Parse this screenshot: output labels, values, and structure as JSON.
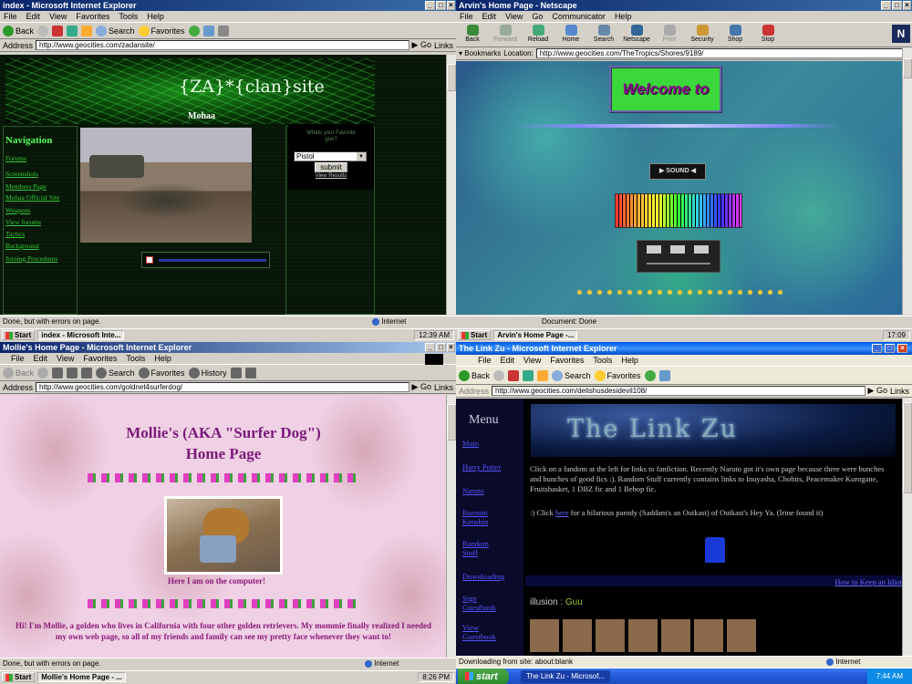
{
  "q1": {
    "title": "index - Microsoft Internet Explorer",
    "menu": [
      "File",
      "Edit",
      "View",
      "Favorites",
      "Tools",
      "Help"
    ],
    "toolbar": {
      "back": "Back",
      "search": "Search",
      "favorites": "Favorites"
    },
    "address_label": "Address",
    "url": "http://www.geocities.com/zadansite/",
    "go": "Go",
    "links": "Links",
    "site_title": "{ZA}*{clan}site",
    "site_sub": "Mohaa",
    "nav_title": "Navigation",
    "nav": [
      "Forums",
      "Screenshots",
      "Members Page",
      "Mohaa Official Site",
      "Weapons",
      "View forums",
      "Tactics",
      "Background",
      "Joining Procedures"
    ],
    "poll": {
      "question": "Whats your Favorite gun?",
      "selected": "Pistol",
      "submit": "submit",
      "results": "View Results"
    },
    "status": "Done, but with errors on page.",
    "zone": "Internet",
    "taskbar": {
      "start": "Start",
      "task": "index - Microsoft Inte...",
      "clock": "12:39 AM"
    }
  },
  "q2": {
    "title": "Arvin's Home Page - Netscape",
    "menu": [
      "File",
      "Edit",
      "View",
      "Go",
      "Communicator",
      "Help"
    ],
    "toolbar": [
      "Back",
      "Forward",
      "Reload",
      "Home",
      "Search",
      "Netscape",
      "Print",
      "Security",
      "Shop",
      "Stop"
    ],
    "bookmarks": "Bookmarks",
    "location_label": "Location:",
    "url": "http://www.geocities.com/TheTropics/Shores/9189/",
    "welcome": "Welcome to",
    "sound": "SOUND",
    "status": "Document: Done",
    "taskbar": {
      "start": "Start",
      "task": "Arvin's Home Page -...",
      "clock": "17:09"
    }
  },
  "q3": {
    "title": "Mollie's Home Page - Microsoft Internet Explorer",
    "menu": [
      "File",
      "Edit",
      "View",
      "Favorites",
      "Tools",
      "Help"
    ],
    "toolbar": {
      "back": "Back",
      "search": "Search",
      "favorites": "Favorites",
      "history": "History"
    },
    "address_label": "Address",
    "url": "http://www.geocities.com/goldnet4surferdog/",
    "go": "Go",
    "links": "Links",
    "heading1": "Mollie's (AKA \"Surfer Dog\")",
    "heading2": "Home Page",
    "caption": "Here I am on the computer!",
    "paragraph": "Hi! I'm Mollie, a golden who lives in California with four other golden retrievers.  My mommie finally realized I needed my own web page, so all of my friends and family can see my pretty face whenever they want to!",
    "status": "Done, but with errors on page.",
    "zone": "Internet",
    "taskbar": {
      "start": "Start",
      "task": "Mollie's Home Page - ...",
      "clock": "8:26 PM"
    }
  },
  "q4": {
    "title": "The Link Zu - Microsoft Internet Explorer",
    "menu": [
      "File",
      "Edit",
      "View",
      "Favorites",
      "Tools",
      "Help"
    ],
    "toolbar": {
      "back": "Back",
      "search": "Search",
      "favorites": "Favorites"
    },
    "address_label": "Address",
    "url": "http://www.geocities.com/delishusdesidevil108/",
    "go": "Go",
    "links": "Links",
    "menu_title": "Menu",
    "side_links": [
      "Main",
      "Harry Potter",
      "Naruto",
      "Rurouni Kenshin",
      "Random Stuff",
      "Downloading",
      "Sign Guestbook",
      "View Guestbook"
    ],
    "banner": "The Link Zu",
    "p1": "Click on a fandom at the left for links to fanfiction. Recently Naruto got it's own page because there were bunches and bunches of good fics :). Random Stuff currently contains links to Inuyasha, Chobits, Peacemaker Kurogane, Fruitsbasket, 1 DBZ fic and 1 Bebop fic.",
    "p2_pre": ":) Click ",
    "p2_link": "here",
    "p2_post": " for a hilarious parody (Saddam's an Outkast) of Outkast's Hey Ya. (Irine found it)",
    "howto": "How to Keep an Idiot",
    "illusion_label": "illusion : ",
    "illusion_name": "Guu",
    "status": "Downloading from site: about:blank",
    "zone": "Internet",
    "taskbar": {
      "start": "start",
      "task": "The Link Zu - Microsof...",
      "clock": "7:44 AM"
    }
  }
}
